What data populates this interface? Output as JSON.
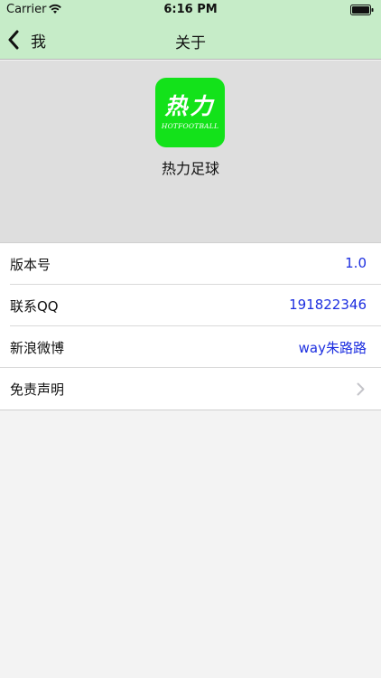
{
  "status": {
    "carrier": "Carrier",
    "time": "6:16 PM"
  },
  "nav": {
    "back_label": "我",
    "title": "关于"
  },
  "header": {
    "logo_cn": "热力",
    "logo_en": "HOTFOOTBALL",
    "app_name": "热力足球"
  },
  "rows": [
    {
      "label": "版本号",
      "value": "1.0"
    },
    {
      "label": "联系QQ",
      "value": "191822346"
    },
    {
      "label": "新浪微博",
      "value": "way朱路路"
    },
    {
      "label": "免责声明",
      "value": ""
    }
  ],
  "colors": {
    "nav_bg": "#c6ecc8",
    "logo_bg": "#13e21a",
    "value_text": "#1c2ee0"
  }
}
